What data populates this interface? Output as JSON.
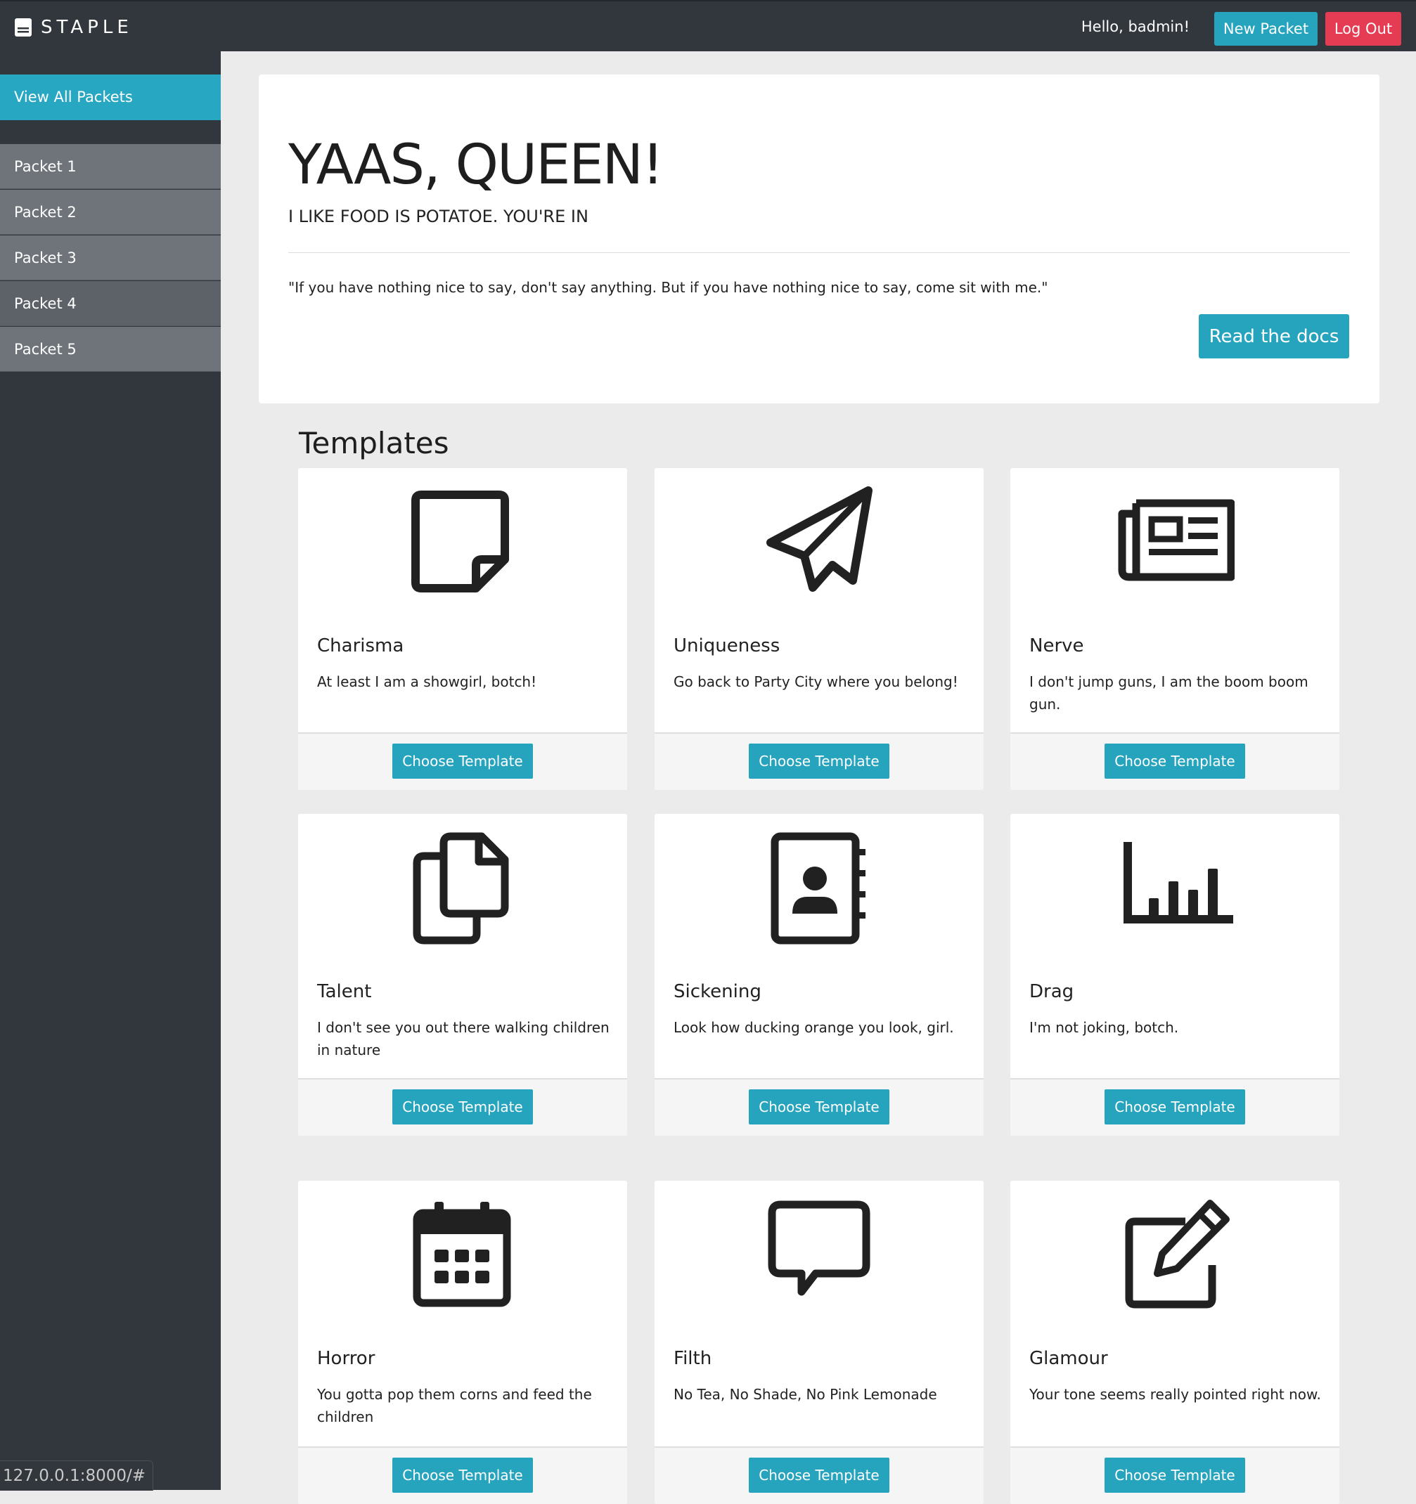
{
  "header": {
    "brand": "STAPLE",
    "greeting": "Hello, badmin!",
    "new_packet": "New Packet",
    "log_out": "Log Out"
  },
  "sidebar": {
    "view_all": "View All Packets",
    "items": [
      {
        "label": "Packet 1"
      },
      {
        "label": "Packet 2"
      },
      {
        "label": "Packet 3"
      },
      {
        "label": "Packet 4"
      },
      {
        "label": "Packet 5"
      }
    ]
  },
  "hero": {
    "title": "YAAS, QUEEN!",
    "subtitle": "I LIKE FOOD IS POTATOE. YOU'RE IN",
    "quote": "\"If you have nothing nice to say, don't say anything. But if you have nothing nice to say, come sit with me.\"",
    "button": "Read the docs"
  },
  "templates": {
    "heading": "Templates",
    "cards": [
      {
        "icon": "sticky-note-icon",
        "title": "Charisma",
        "text": "At least I am a showgirl, botch!",
        "button": "Choose Template"
      },
      {
        "icon": "paper-plane-icon",
        "title": "Uniqueness",
        "text": "Go back to Party City where you belong!",
        "button": "Choose Template"
      },
      {
        "icon": "newspaper-icon",
        "title": "Nerve",
        "text": "I don't jump guns, I am the boom boom gun.",
        "button": "Choose Template"
      },
      {
        "icon": "copy-files-icon",
        "title": "Talent",
        "text": "I don't see you out there walking children in nature",
        "button": "Choose Template"
      },
      {
        "icon": "address-book-icon",
        "title": "Sickening",
        "text": "Look how ducking orange you look, girl.",
        "button": "Choose Template"
      },
      {
        "icon": "bar-chart-icon",
        "title": "Drag",
        "text": "I'm not joking, botch.",
        "button": "Choose Template"
      },
      {
        "icon": "calendar-icon",
        "title": "Horror",
        "text": "You gotta pop them corns and feed the children",
        "button": "Choose Template"
      },
      {
        "icon": "speech-bubble-icon",
        "title": "Filth",
        "text": "No Tea, No Shade, No Pink Lemonade",
        "button": "Choose Template"
      },
      {
        "icon": "edit-pencil-icon",
        "title": "Glamour",
        "text": "Your tone seems really pointed right now.",
        "button": "Choose Template"
      }
    ]
  },
  "status_bar": {
    "url": "127.0.0.1:8000/#"
  },
  "colors": {
    "accent": "#26a4be",
    "danger": "#e63c53",
    "sidebar_bg": "#32363d",
    "page_bg": "#ebebeb"
  }
}
